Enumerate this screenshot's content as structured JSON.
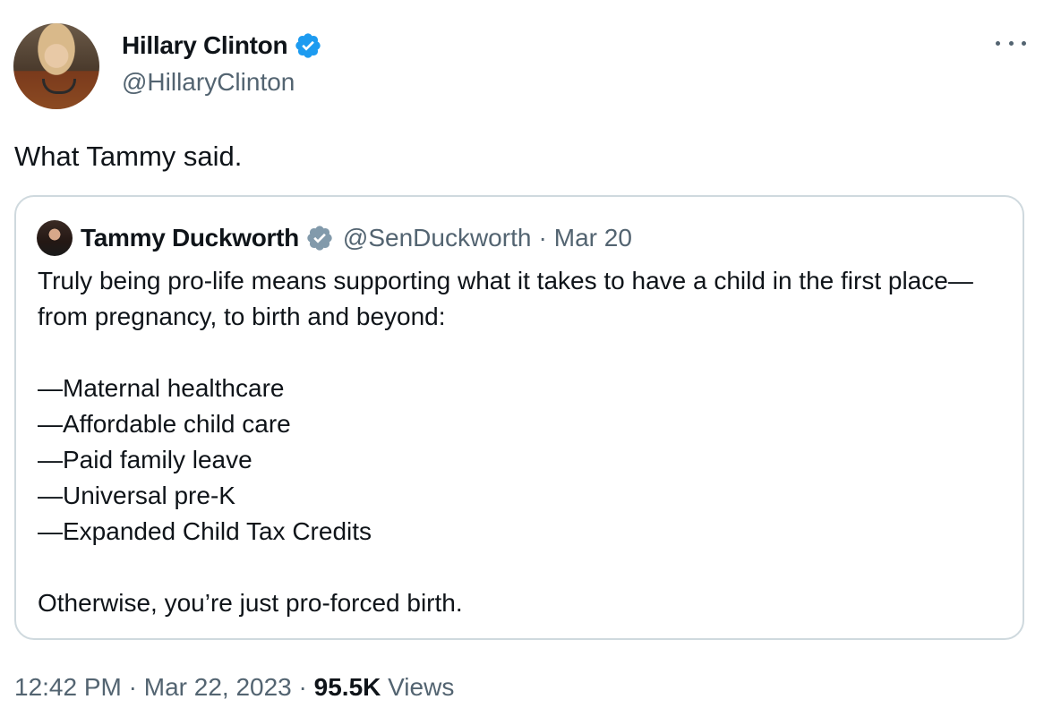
{
  "author": {
    "name": "Hillary Clinton",
    "handle": "@HillaryClinton",
    "verified_color": "#1d9bf0",
    "avatar_icon": "avatar-photo"
  },
  "more_icon": "more-horizontal-icon",
  "tweet": {
    "text": "What Tammy said."
  },
  "quote": {
    "name": "Tammy Duckworth",
    "handle": "@SenDuckworth",
    "separator": "·",
    "date": "Mar 20",
    "verified_color": "#829aab",
    "intro": "Truly being pro-life means supporting what it takes to have a child in the first place—from pregnancy, to birth and beyond:",
    "items": [
      "—Maternal healthcare",
      "—Affordable child care",
      "—Paid family leave",
      "—Universal pre-K",
      "—Expanded Child Tax Credits"
    ],
    "closing": "Otherwise, you’re just pro-forced birth."
  },
  "meta": {
    "time": "12:42 PM",
    "separator": "·",
    "date": "Mar 22, 2023",
    "views_count": "95.5K",
    "views_label": "Views"
  }
}
